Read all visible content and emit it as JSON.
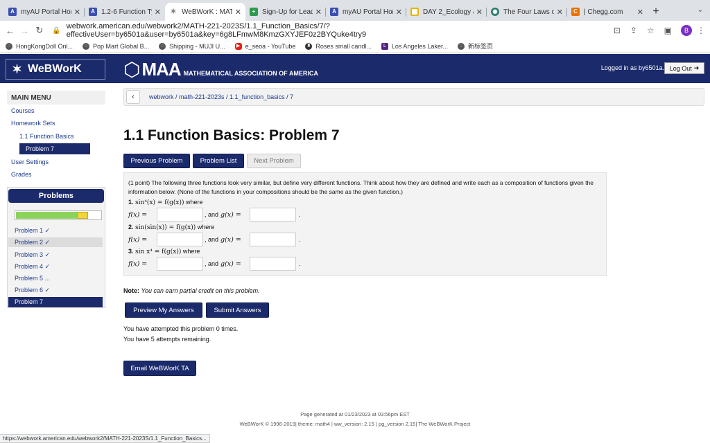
{
  "browser": {
    "tabs": [
      {
        "title": "myAU Portal Hom",
        "icon": "au-icon",
        "color": "#3a4fb0"
      },
      {
        "title": "1.2-6 Function Ty",
        "icon": "au-icon",
        "color": "#3a4fb0"
      },
      {
        "title": "WeBWorK : MATH",
        "icon": "webwork-star-icon",
        "color": "#7a7a7a"
      },
      {
        "title": "Sign-Up for Lead",
        "icon": "plus-icon",
        "color": "#2d9a4f"
      },
      {
        "title": "myAU Portal Hom",
        "icon": "au-icon",
        "color": "#3a4fb0"
      },
      {
        "title": "DAY 2_Ecology &",
        "icon": "doc-icon",
        "color": "#e8b400"
      },
      {
        "title": "The Four Laws of",
        "icon": "globe-icon",
        "color": "#2e7d6b"
      },
      {
        "title": "| Chegg.com",
        "icon": "chegg-icon",
        "color": "#eb7100"
      }
    ],
    "active_tab": 2,
    "url": "webwork.american.edu/webwork2/MATH-221-2023S/1.1_Function_Basics/7/?effectiveUser=by6501a&user=by6501a&key=6g8LFmwM8KmzGXYJEF0z2BYQuke4try9",
    "profile_initial": "B",
    "bookmarks": [
      {
        "label": "HongKongDoll Onl...",
        "color": "#333"
      },
      {
        "label": "Pop Mart Global B...",
        "color": "#333"
      },
      {
        "label": "Shipping - MUJI U...",
        "color": "#333"
      },
      {
        "label": "e_seoa - YouTube",
        "color": "#e62117"
      },
      {
        "label": "Roses small candl...",
        "color": "#333"
      },
      {
        "label": "Los Angeles Laker...",
        "color": "#552583"
      },
      {
        "label": "新标签页",
        "color": "#333"
      }
    ],
    "status_url": "https://webwork.american.edu/webwork2/MATH-221-2023S/1.1_Function_Basics..."
  },
  "header": {
    "logo_text": "WeBWorK",
    "maa_big": "MAA",
    "maa_small": "MATHEMATICAL ASSOCIATION OF AMERICA",
    "logged_in": "Logged in as by6501a.",
    "logout": "Log Out"
  },
  "sidebar": {
    "main_menu": "MAIN MENU",
    "courses": "Courses",
    "homework_sets": "Homework Sets",
    "set_name": "1.1 Function Basics",
    "current_problem": "Problem 7",
    "user_settings": "User Settings",
    "grades": "Grades",
    "problems_header": "Problems",
    "progress_complete_fraction": 0.72,
    "problems": [
      {
        "label": "Problem 1 ✓"
      },
      {
        "label": "Problem 2 ✓"
      },
      {
        "label": "Problem 3 ✓"
      },
      {
        "label": "Problem 4 ✓"
      },
      {
        "label": "Problem 5 ..."
      },
      {
        "label": "Problem 6 ✓"
      },
      {
        "label": "Problem 7"
      }
    ]
  },
  "main": {
    "breadcrumb": "webwork / math-221-2023s / 1.1_function_basics / 7",
    "title": "1.1 Function Basics: Problem 7",
    "buttons": {
      "previous": "Previous Problem",
      "list": "Problem List",
      "next": "Next Problem"
    },
    "question": {
      "intro": "(1 point) The following three functions look very similar, but define very different functions. Think about how they are defined and write each as a composition of functions given the information below. (None of the functions in your compositions should be the same as the given function.)",
      "parts": [
        {
          "label": "1.",
          "expr": "sin⁴(x) = f(g(x))",
          "where": "where"
        },
        {
          "label": "2.",
          "expr": "sin(sin(x)) = f(g(x))",
          "where": "where"
        },
        {
          "label": "3.",
          "expr": "sin x⁴ = f(g(x))",
          "where": "where"
        }
      ],
      "f_label": "f(x) =",
      "and_text": ", and",
      "g_label": "g(x) =",
      "period": ".",
      "f_values": [
        "",
        "",
        ""
      ],
      "g_values": [
        "",
        "",
        ""
      ]
    },
    "note_label": "Note:",
    "note_text": "You can earn partial credit on this problem.",
    "preview_button": "Preview My Answers",
    "submit_button": "Submit Answers",
    "attempted": "You have attempted this problem 0 times.",
    "remaining": "You have 5 attempts remaining.",
    "email_button": "Email WeBWorK TA"
  },
  "footer": {
    "generated": "Page generated at 01/23/2023 at 03:56pm EST",
    "credits": "WeBWorK © 1996-2019| theme: math4 | ww_version: 2.15 | pg_version 2.15| The WeBWorK Project"
  }
}
